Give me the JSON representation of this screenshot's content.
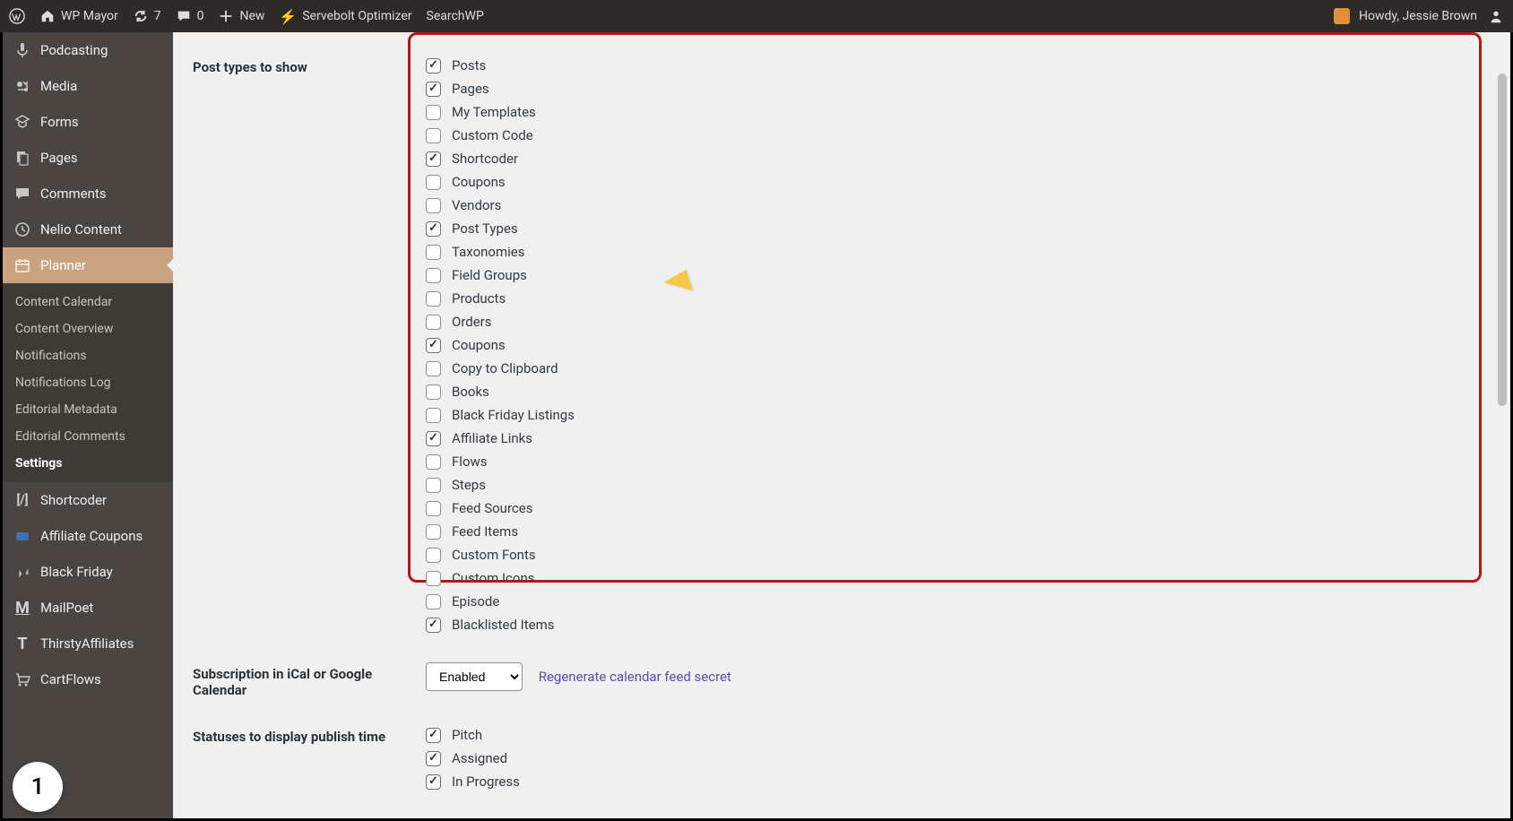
{
  "adminbar": {
    "site_name": "WP Mayor",
    "updates": "7",
    "comments": "0",
    "new_label": "New",
    "servebolt": "Servebolt Optimizer",
    "searchwp": "SearchWP",
    "howdy": "Howdy, Jessie Brown"
  },
  "sidebar": {
    "top": [
      {
        "icon": "mic",
        "label": "Podcasting"
      },
      {
        "icon": "media",
        "label": "Media"
      },
      {
        "icon": "forms",
        "label": "Forms"
      },
      {
        "icon": "pages",
        "label": "Pages"
      },
      {
        "icon": "comments",
        "label": "Comments"
      },
      {
        "icon": "clock",
        "label": "Nelio Content"
      },
      {
        "icon": "calendar",
        "label": "Planner",
        "current": true
      }
    ],
    "submenu": [
      {
        "label": "Content Calendar"
      },
      {
        "label": "Content Overview"
      },
      {
        "label": "Notifications"
      },
      {
        "label": "Notifications Log"
      },
      {
        "label": "Editorial Metadata"
      },
      {
        "label": "Editorial Comments"
      },
      {
        "label": "Settings",
        "current": true
      }
    ],
    "bottom": [
      {
        "icon": "code",
        "label": "Shortcoder"
      },
      {
        "icon": "coupon",
        "label": "Affiliate Coupons"
      },
      {
        "icon": "pin",
        "label": "Black Friday"
      },
      {
        "icon": "m",
        "label": "MailPoet"
      },
      {
        "icon": "t",
        "label": "ThirstyAffiliates"
      },
      {
        "icon": "cart",
        "label": "CartFlows"
      }
    ]
  },
  "settings": {
    "post_types_label": "Post types to show",
    "post_types": [
      {
        "label": "Posts",
        "checked": true
      },
      {
        "label": "Pages",
        "checked": true
      },
      {
        "label": "My Templates",
        "checked": false
      },
      {
        "label": "Custom Code",
        "checked": false
      },
      {
        "label": "Shortcoder",
        "checked": true
      },
      {
        "label": "Coupons",
        "checked": false
      },
      {
        "label": "Vendors",
        "checked": false
      },
      {
        "label": "Post Types",
        "checked": true
      },
      {
        "label": "Taxonomies",
        "checked": false
      },
      {
        "label": "Field Groups",
        "checked": false
      },
      {
        "label": "Products",
        "checked": false
      },
      {
        "label": "Orders",
        "checked": false
      },
      {
        "label": "Coupons",
        "checked": true
      },
      {
        "label": "Copy to Clipboard",
        "checked": false
      },
      {
        "label": "Books",
        "checked": false
      },
      {
        "label": "Black Friday Listings",
        "checked": false
      },
      {
        "label": "Affiliate Links",
        "checked": true
      },
      {
        "label": "Flows",
        "checked": false
      },
      {
        "label": "Steps",
        "checked": false
      },
      {
        "label": "Feed Sources",
        "checked": false
      },
      {
        "label": "Feed Items",
        "checked": false
      },
      {
        "label": "Custom Fonts",
        "checked": false
      },
      {
        "label": "Custom Icons",
        "checked": false
      },
      {
        "label": "Episode",
        "checked": false
      },
      {
        "label": "Blacklisted Items",
        "checked": true
      }
    ],
    "subscription_label": "Subscription in iCal or Google Calendar",
    "subscription_value": "Enabled",
    "regenerate_label": "Regenerate calendar feed secret",
    "statuses_label": "Statuses to display publish time",
    "statuses": [
      {
        "label": "Pitch",
        "checked": true
      },
      {
        "label": "Assigned",
        "checked": true
      },
      {
        "label": "In Progress",
        "checked": true
      }
    ]
  },
  "badge": "1"
}
